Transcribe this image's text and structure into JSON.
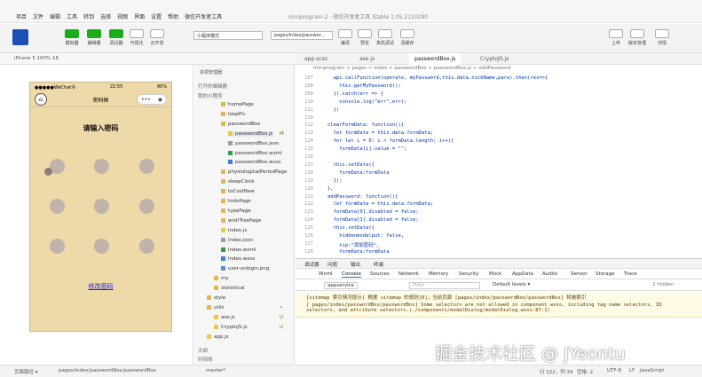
{
  "menubar": {
    "items": [
      "项目",
      "文件",
      "编辑",
      "工具",
      "转到",
      "选择",
      "视图",
      "界面",
      "设置",
      "帮助",
      "微信开发者工具"
    ],
    "window_title": "miniprogram-2 · 微信开发者工具 Stable 1.05.2110290"
  },
  "toolbar": {
    "left_buttons": [
      "模拟器",
      "编辑器",
      "调试器",
      "可视化",
      "云开发"
    ],
    "mode_select": "小程序模式",
    "page_select": "pages/index/passwor...",
    "mid_buttons": [
      "编译",
      "预览",
      "真机调试",
      "清缓存"
    ],
    "right_buttons": [
      "上传",
      "版本管理",
      "详情"
    ]
  },
  "device_bar": {
    "device": "iPhone 5 100% 16"
  },
  "phone": {
    "carrier": "●●●●●WeChat令",
    "time": "22:55",
    "battery": "90%",
    "nav_title": "密码框",
    "prompt": "请输入密码",
    "modify_link": "修改密码"
  },
  "explorer": {
    "title": "资源管理器",
    "open_editors": "打开的编辑器",
    "project": "我的小程序",
    "items": [
      {
        "label": "homePage",
        "type": "folder",
        "indent": 2
      },
      {
        "label": "loopPic",
        "type": "folder",
        "indent": 2
      },
      {
        "label": "passwordBox",
        "type": "folder",
        "indent": 2
      },
      {
        "label": "passwordBox.js",
        "type": "js",
        "indent": 3,
        "badge": "M",
        "selected": true
      },
      {
        "label": "passwordBox.json",
        "type": "json",
        "indent": 3
      },
      {
        "label": "passwordBox.wxml",
        "type": "wxml",
        "indent": 3
      },
      {
        "label": "passwordBox.wxss",
        "type": "wxss",
        "indent": 3
      },
      {
        "label": "physiologicalPeriodPage",
        "type": "folder",
        "indent": 2
      },
      {
        "label": "sleepClock",
        "type": "folder",
        "indent": 2
      },
      {
        "label": "toCostNew",
        "type": "folder",
        "indent": 2
      },
      {
        "label": "todoPage",
        "type": "folder",
        "indent": 2
      },
      {
        "label": "typePage",
        "type": "folder",
        "indent": 2
      },
      {
        "label": "wishTreePage",
        "type": "folder",
        "indent": 2
      },
      {
        "label": "index.js",
        "type": "js",
        "indent": 2
      },
      {
        "label": "index.json",
        "type": "json",
        "indent": 2
      },
      {
        "label": "index.wxml",
        "type": "wxml",
        "indent": 2
      },
      {
        "label": "index.wxss",
        "type": "wxss",
        "indent": 2
      },
      {
        "label": "user-unlogin.png",
        "type": "png",
        "indent": 2
      },
      {
        "label": "my",
        "type": "folder",
        "indent": 1
      },
      {
        "label": "statistical",
        "type": "folder",
        "indent": 1
      },
      {
        "label": "style",
        "type": "folder",
        "indent": 0
      },
      {
        "label": "utils",
        "type": "folder",
        "indent": 0,
        "badge": "•"
      },
      {
        "label": "ase.js",
        "type": "js",
        "indent": 1,
        "badge": "U"
      },
      {
        "label": "CryptoJS.js",
        "type": "js",
        "indent": 1,
        "badge": "U"
      },
      {
        "label": "app.js",
        "type": "js",
        "indent": 0
      }
    ],
    "outline": "大纲",
    "timeline": "时间线"
  },
  "editor": {
    "tabs": [
      "app.scss",
      "ase.js",
      "passwordBox.js",
      "CryptoJS.js"
    ],
    "breadcrumb": "miniprogram > pages > index > passwordBox > passwordBox.js > addPassword",
    "lines": [
      {
        "n": "107",
        "code": "  api.callFunction(operate, myPassword,this.data.nickName,para).then(res=>{"
      },
      {
        "n": "108",
        "code": "    this.getMyPassword();"
      },
      {
        "n": "109",
        "code": "  }).catch(err => {"
      },
      {
        "n": "110",
        "code": "    console.log(\"err\",err);"
      },
      {
        "n": "111",
        "code": "  })"
      },
      {
        "n": "110",
        "code": ""
      },
      {
        "n": "112",
        "code": "clearFormData: function(){"
      },
      {
        "n": "113",
        "code": "  let formData = this.data.formData;"
      },
      {
        "n": "114",
        "code": "  for let i = 0; i < formData.length; i++){"
      },
      {
        "n": "115",
        "code": "    formData[i].value = \"\";"
      },
      {
        "n": "116",
        "code": ""
      },
      {
        "n": "117",
        "code": "  this.setData({"
      },
      {
        "n": "118",
        "code": "    formData:formData"
      },
      {
        "n": "119",
        "code": "  });"
      },
      {
        "n": "120",
        "code": "},"
      },
      {
        "n": "121",
        "code": "addPassword: function(){"
      },
      {
        "n": "122",
        "code": "  let formData = this.data.formData;"
      },
      {
        "n": "123",
        "code": "  formData[0].disabled = false;"
      },
      {
        "n": "124",
        "code": "  formData[1].disabled = false;"
      },
      {
        "n": "125",
        "code": "  this.setData({"
      },
      {
        "n": "126",
        "code": "    hiddenmodalput: false,"
      },
      {
        "n": "127",
        "code": "    tip:\"添加密码\","
      },
      {
        "n": "128",
        "code": "    formData:formData"
      }
    ]
  },
  "debugger": {
    "tabs": [
      "调试器",
      "问题",
      "输出",
      "终端"
    ],
    "panel_tabs": [
      "Wxml",
      "Console",
      "Sources",
      "Network",
      "Memory",
      "Security",
      "Mock",
      "AppData",
      "Audits",
      "Sensor",
      "Storage",
      "Trace"
    ],
    "context": "appservice",
    "filter_placeholder": "Filter",
    "levels": "Default levels ▾",
    "hidden": "2 hidden",
    "messages": [
      "[sitemap 索引情况提示] 根据 sitemap 的规则[0]，当前页面 [pages/index/passwordBox/passwordBox] 将被索引",
      "[ pages/index/passwordBox/passwordBox] Some selectors are not allowed in component wxss, including tag name selectors, ID selectors, and attribute selectors.(./components/modalDialog/modalDialog.wxss:87:1)"
    ]
  },
  "statusbar": {
    "left": "页面路径 ▾",
    "path": "pages/index/passwordBox/passwordBox",
    "branch": "master*",
    "position": "行 122，列 34",
    "spaces": "空格: 2",
    "encoding": "UTF-8",
    "eol": "LF",
    "language": "JavaScript"
  },
  "watermark": "掘金技术社区 @ JYeontu"
}
